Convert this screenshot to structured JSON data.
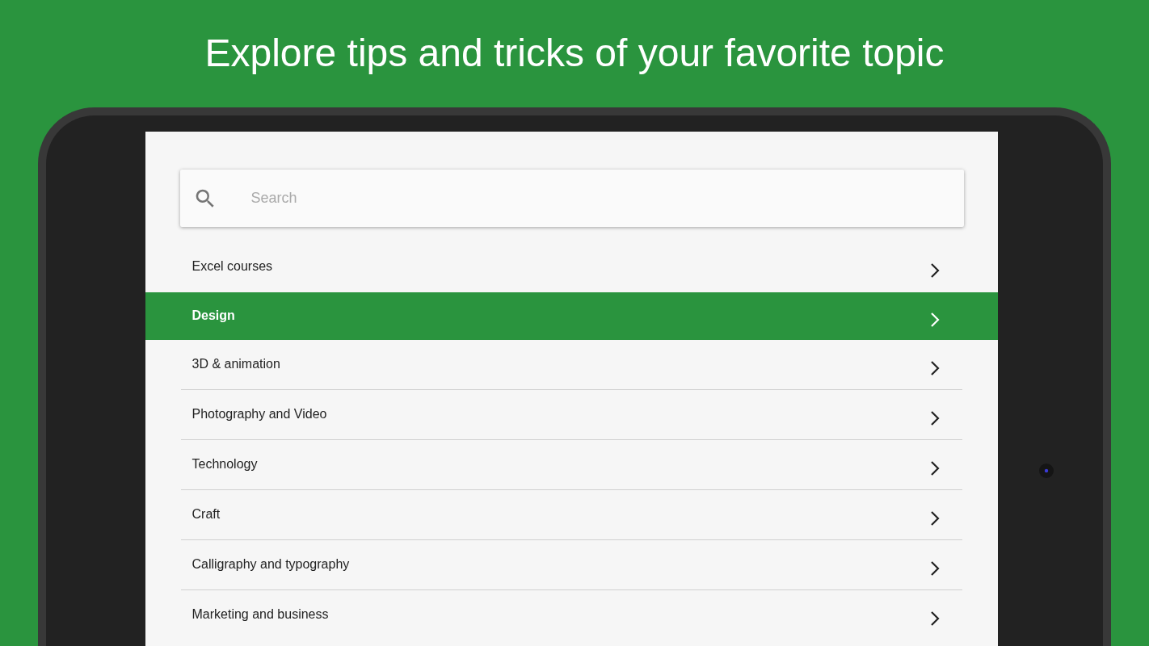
{
  "headline": "Explore tips and tricks of your favorite topic",
  "search": {
    "placeholder": "Search"
  },
  "topics": [
    {
      "label": "Excel courses",
      "selected": false
    },
    {
      "label": "Design",
      "selected": true
    },
    {
      "label": "3D & animation",
      "selected": false
    },
    {
      "label": "Photography and Video",
      "selected": false
    },
    {
      "label": "Technology",
      "selected": false
    },
    {
      "label": "Craft",
      "selected": false
    },
    {
      "label": "Calligraphy and typography",
      "selected": false
    },
    {
      "label": "Marketing and business",
      "selected": false
    }
  ]
}
